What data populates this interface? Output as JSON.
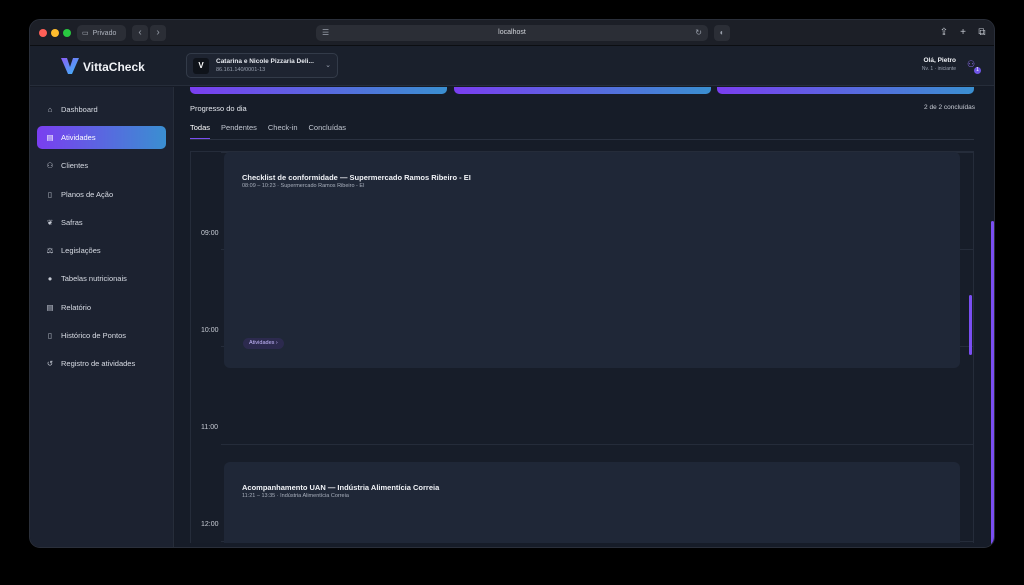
{
  "browser": {
    "private_label": "Privado",
    "url": "localhost"
  },
  "app": {
    "name": "VittaCheck",
    "company_name": "Catarina e Nicole Pizzaria Deli...",
    "company_cnpj": "86.161.140/0001-13",
    "user_greeting": "Olá, Pietro",
    "user_role": "Nv. 1 · iniciante",
    "notification_count": "1"
  },
  "sidebar": {
    "items": [
      {
        "label": "Dashboard",
        "icon": "home-icon"
      },
      {
        "label": "Atividades",
        "icon": "clipboard-icon"
      },
      {
        "label": "Clientes",
        "icon": "users-icon"
      },
      {
        "label": "Planos de Ação",
        "icon": "file-icon"
      },
      {
        "label": "Safras",
        "icon": "sprout-icon"
      },
      {
        "label": "Legislações",
        "icon": "scale-icon"
      },
      {
        "label": "Tabelas nutricionais",
        "icon": "apple-icon"
      },
      {
        "label": "Relatório",
        "icon": "report-icon"
      },
      {
        "label": "Histórico de Pontos",
        "icon": "document-icon"
      },
      {
        "label": "Registro de atividades",
        "icon": "history-icon"
      }
    ],
    "active": "Atividades"
  },
  "main": {
    "progress_title": "Progresso do dia",
    "progress_count": "2 de 2 concluídas",
    "tabs": [
      "Todas",
      "Pendentes",
      "Check-in",
      "Concluídas"
    ],
    "active_tab": "Todas",
    "hours": [
      "09:00",
      "10:00",
      "11:00",
      "12:00"
    ],
    "events": [
      {
        "title": "Checklist de conformidade — Supermercado Ramos Ribeiro - EI",
        "time": "08:09 – 10:23 · Supermercado Ramos Ribeiro - EI",
        "tag": "Atividades"
      },
      {
        "title": "Acompanhamento UAN — Indústria Alimentícia Correia",
        "time": "11:21 – 13:35 · Indústria Alimentícia Correia",
        "tag": ""
      }
    ]
  },
  "colors": {
    "accent": "#7a4ef2",
    "gradient_start": "#7a3ef0",
    "gradient_end": "#3a8fd1"
  }
}
